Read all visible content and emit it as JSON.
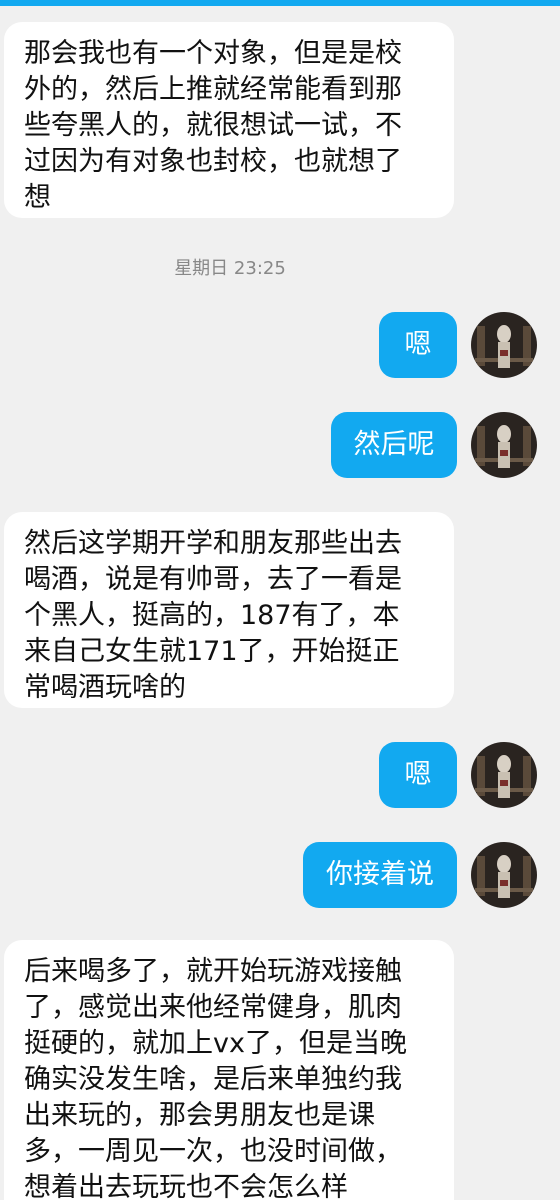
{
  "messages": [
    {
      "text": "那会我也有一个对象，但是是校\n外的，然后上推就经常能看到那\n些夸黑人的，就很想试一试，不\n过因为有对象也封校，也就想了\n想"
    },
    {
      "text": "嗯"
    },
    {
      "text": "然后呢"
    },
    {
      "text": "然后这学期开学和朋友那些出去\n喝酒，说是有帅哥，去了一看是\n个黑人，挺高的，187有了，本\n来自己女生就171了，开始挺正\n常喝酒玩啥的"
    },
    {
      "text": "嗯"
    },
    {
      "text": "你接着说"
    },
    {
      "text": "后来喝多了，就开始玩游戏接触\n了，感觉出来他经常健身，肌肉\n挺硬的，就加上vx了，但是当晚\n确实没发生啥，是后来单独约我\n出来玩的，那会男朋友也是课\n多，一周见一次，也没时间做，\n想着出去玩玩也不会怎么样"
    }
  ],
  "timestamp": "星期日 23:25",
  "colors": {
    "accent": "#12a9f0",
    "background": "#f0f0f0",
    "incoming_bubble": "#ffffff",
    "outgoing_text": "#ffffff"
  },
  "avatar_icon": "dark-portrait-avatar"
}
